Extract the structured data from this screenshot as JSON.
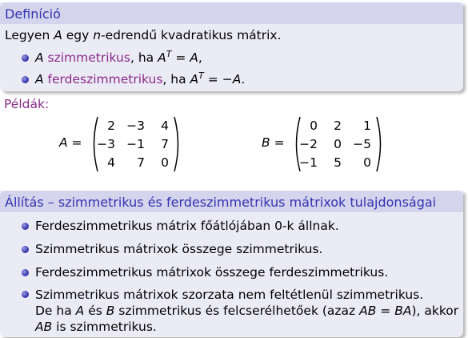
{
  "definition": {
    "title": "Definíció",
    "intro": {
      "a": "Legyen ",
      "b": "A",
      "c": " egy ",
      "d": "n",
      "e": "-edrendű kvadratikus mátrix."
    },
    "items": [
      {
        "pre": "A",
        "term": "szimmetrikus",
        "mid": ", ha ",
        "lhs": "A",
        "sup": "T",
        "eq": " = ",
        "rhs": "A",
        "end": ","
      },
      {
        "pre": "A",
        "term": "ferdeszimmetrikus",
        "mid": ", ha ",
        "lhs": "A",
        "sup": "T",
        "eq": " = −",
        "rhs": "A",
        "end": "."
      }
    ]
  },
  "examples": {
    "label": "Példák:",
    "matrices": [
      {
        "name": "A",
        "eq": " =",
        "rows": [
          [
            "2",
            "−3",
            "4"
          ],
          [
            "−3",
            "−1",
            "7"
          ],
          [
            "4",
            "7",
            "0"
          ]
        ]
      },
      {
        "name": "B",
        "eq": " =",
        "rows": [
          [
            "0",
            "2",
            "1"
          ],
          [
            "−2",
            "0",
            "−5"
          ],
          [
            "−1",
            "5",
            "0"
          ]
        ]
      }
    ]
  },
  "theorem": {
    "title": "Állítás – szimmetrikus és ferdeszimmetrikus mátrixok tulajdonságai",
    "items": [
      "Ferdeszimmetrikus mátrix főátlójában 0-k állnak.",
      "Szimmetrikus mátrixok összege szimmetrikus.",
      "Ferdeszimmetrikus mátrixok összege ferdeszimmetrikus."
    ],
    "last": {
      "line1": "Szimmetrikus mátrixok szorzata nem feltétlenül szimmetrikus.",
      "l2a": "De ha ",
      "l2b": "A",
      "l2c": " és ",
      "l2d": "B",
      "l2e": " szimmetrikus és felcserélhetőek (azaz ",
      "l2f": "AB",
      "l2g": " = ",
      "l2h": "BA",
      "l2i": "), akkor",
      "l3a": "AB",
      "l3b": " is szimmetrikus."
    }
  },
  "colors": {
    "block_title_bg": "#d4d4ec",
    "block_title_text": "#3333b3",
    "block_body_bg": "#ebebf6",
    "term_purple": "#8b2a8b",
    "bullet_blue": "#4040b8"
  }
}
